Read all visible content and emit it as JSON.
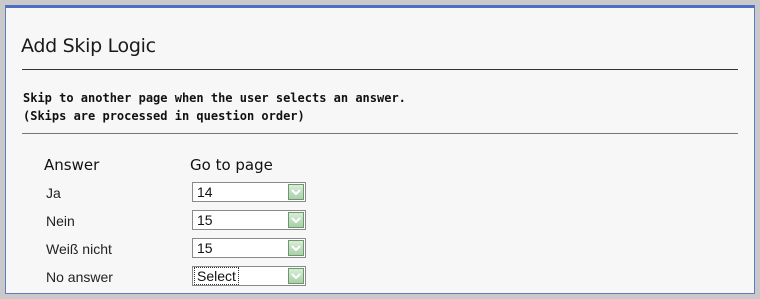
{
  "dialog": {
    "title": "Add Skip Logic",
    "instruction_line1": "Skip to another page when the user selects an answer.",
    "instruction_line2": "(Skips are processed in question order)"
  },
  "table": {
    "headers": {
      "answer": "Answer",
      "go_to_page": "Go to page"
    },
    "rows": [
      {
        "answer": "Ja",
        "page": "14"
      },
      {
        "answer": "Nein",
        "page": "15"
      },
      {
        "answer": "Weiß nicht",
        "page": "15"
      },
      {
        "answer": "No answer",
        "page": "Select"
      }
    ]
  },
  "colors": {
    "window_border": "#4a6fc3",
    "dropdown_button": "#a9cfa9"
  },
  "icons": {
    "dropdown": "chevron-down-icon"
  }
}
